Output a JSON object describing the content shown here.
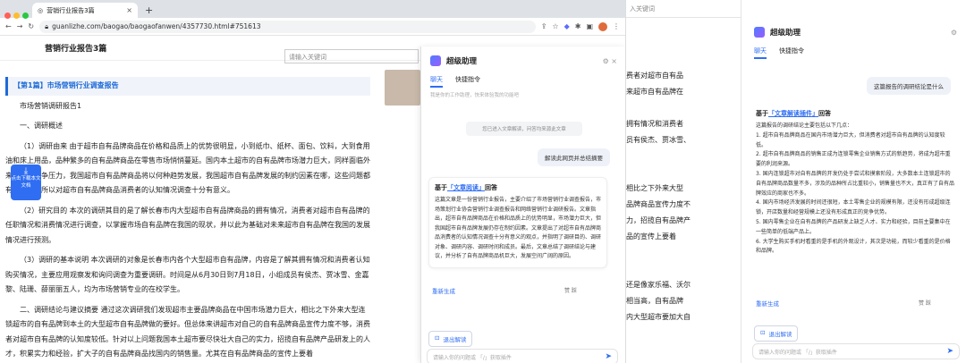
{
  "browser": {
    "tab_title": "营销行业报告3篇",
    "url": "guanlizhe.com/baogao/baogaofanwen/4357730.html#751613"
  },
  "site": {
    "header_title": "营销行业报告3篇",
    "search_placeholder": "请输入关键词"
  },
  "article": {
    "heading": "【第1篇】市场营销行业调查报告",
    "p1": "市场营销调研报告1",
    "p2": "一、调研概述",
    "p3": "（1）调研由来 由于超市自有品牌商品在价格和品质上的优势很明显，小到纸巾、纸杯、面包、饮料，大到食用油和床上用品，品种繁多的自有品牌商品在零售市场悄悄蔓延。国内本土超市的自有品牌市场潜力巨大，同样面临外来超市的竞争压力，我国超市自有品牌商品将以何种趋势发展，我国超市自有品牌发展的制约因素在哪，这些问题都有待解决。所以对超市自有品牌商品消费者的认知情况调查十分有意义。",
    "p4": "（2）研究目的 本次的调研其目的是了解长春市内大型超市自有品牌商品的拥有情况，消费者对超市自有品牌的任职情况和消费情况进行调查，以掌握市场自有品牌在我国的现状，并以此为基础对未来超市自有品牌在我国的发展情况进行预测。",
    "p5": "（3）调研的基本说明 本次调研的对象是长春市内各个大型超市自有品牌，内容是了解其拥有情况和消费者认知购买情况，主要应用观察发和询问调查为重要调研。时间是从6月30日到7月18日，小组成员有侯杰、贾冰雪、金嘉黎、陆珊、薛丽丽五人，均为市场营销专业的在校学生。",
    "p6": "二、调研结论与建议摘要 通过这次调研我们发现超市主要品牌商品在中国市场潜力巨大，相比之下外来大型连锁超市的自有品牌到本土的大型超市自有品牌做的要好。但总体来讲超市对自己的自有品牌商品宣传力度不够，消费者对超市自有品牌的认知度较低。针对以上问题我国本土超市要尽快壮大自己的实力，招揽自有品牌产品研发上的人才，积累实力和经验，扩大子的自有品牌商品找国内的销售量。尤其在自有品牌商品的宣传上要着",
    "float_btn": "点击下载本文文档"
  },
  "assistant1": {
    "title": "超级助理",
    "tab_chat": "聊天",
    "tab_quick": "快捷指令",
    "faded": "我是你的工作助理，快来体验我的功能吧",
    "notice": "您已进入文章解读，问答均来源此文章",
    "user_msg": "解读此网页并总结摘要",
    "card_title_prefix": "基于",
    "card_title_link": "「文章阅读」",
    "card_title_suffix": "回答",
    "card_body": "这篇文章是一份营销行业报告，主要介绍了市场营销行业调查报告，市场策划行业协会营销行业调查报告和网络营销行业调研报告。文章指出，超市自有品牌商品在价格和品质上的优势明显，市场潜力巨大，但我国超市自有品牌发展仍存在制约因素。文章提出了对超市自有品牌商品消费者的认知情况调查十分有意义的观点，并指明了调研目的、调研对象、调研内容、调研时间和成员。最后，文章总结了调研结论与建议，并分析了自有品牌商品机巨大，发展空间广阔的原因。",
    "regen": "重新生成",
    "likes": "赞  踩",
    "exit": "退出解读",
    "input_placeholder": "请输入你的问题或 「/」获取插件"
  },
  "middle": {
    "search_placeholder": "入关键词",
    "lines": [
      "费者对超市自有品",
      "来超市自有品牌在",
      "",
      "拥有情况和消费者",
      "员有侯杰、贾冰雪、",
      "",
      "",
      "相比之下外来大型",
      "品牌商品宣传力度不",
      "力，招揽自有品牌产",
      "品的宣传上要着",
      "",
      "",
      "还是像家乐福、沃尔",
      "相当高，自有品牌",
      "内大型超市要加大自"
    ]
  },
  "assistant2": {
    "title": "超级助理",
    "tab_chat": "聊天",
    "tab_quick": "快捷指令",
    "user_msg": "这篇报告的调研结论是什么",
    "card_title_prefix": "基于",
    "card_title_link": "「文章解读插件」",
    "card_title_suffix": "回答",
    "card_body": "这篇报告的调研结论主要包括以下几点：\n1. 超市自有品牌商品在国内市场潜力巨大，但消费者对超市自有品牌的认知度较低。\n2. 超市自有品牌商品的销售正成为连锁零售企业销售方式的新趋势，将成为超市重要的利润来源。\n3. 国内连锁超市对自有品牌的开发仍处于尝试和摸索阶段，大多数本土连锁超市的自有品牌商品数量不多，涉及的品种所占比重较小，销售量也不大，真正有了自有品牌效应的商家也不多。\n4. 国内市场经济发展的时间还很短，本土零售企业的规模有限，还没有形成超级连锁，开店数量和经营规模上还没有形成真正的竞争优势。\n5. 国内零售企业在自有品牌的产品研发上缺乏人才、实力和经验，目前主要集中在一些简单的低端产品上。\n6. 大学生购买手机时看重的是手机的外观设计，其次是功能，而较少看重的是价格和品牌。",
    "regen": "重新生成",
    "likes": "赞  踩",
    "exit": "退出解读",
    "input_placeholder": "请输入你的问题或 「/」获取插件"
  }
}
